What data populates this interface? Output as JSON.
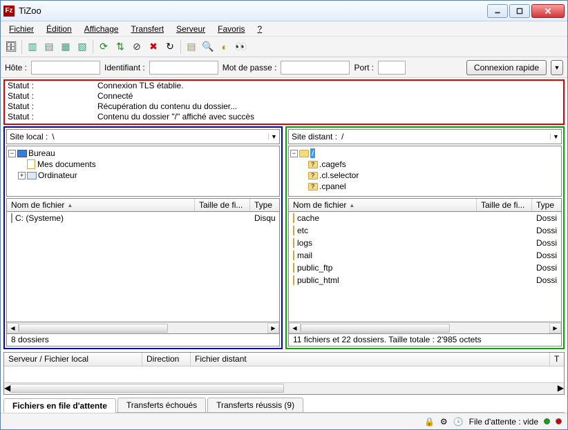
{
  "window": {
    "title": "TiZoo"
  },
  "menu": {
    "file": "Fichier",
    "edit": "Édition",
    "view": "Affichage",
    "transfer": "Transfert",
    "server": "Serveur",
    "bookmarks": "Favoris",
    "help": "?"
  },
  "quickconnect": {
    "host_label": "Hôte :",
    "user_label": "Identifiant :",
    "pass_label": "Mot de passe :",
    "port_label": "Port :",
    "button": "Connexion rapide"
  },
  "log": [
    {
      "label": "Statut :",
      "msg": "Connexion TLS établie."
    },
    {
      "label": "Statut :",
      "msg": "Connecté"
    },
    {
      "label": "Statut :",
      "msg": "Récupération du contenu du dossier..."
    },
    {
      "label": "Statut :",
      "msg": "Contenu du dossier \"/\" affiché avec succès"
    }
  ],
  "local": {
    "label": "Site local :",
    "path": "\\",
    "tree": {
      "root": "Bureau",
      "docs": "Mes documents",
      "computer": "Ordinateur"
    },
    "columns": {
      "name": "Nom de fichier",
      "size": "Taille de fi...",
      "type": "Type"
    },
    "rows": [
      {
        "name": "C: (Systeme)",
        "type": "Disqu"
      }
    ],
    "status": "8 dossiers"
  },
  "remote": {
    "label": "Site distant :",
    "path": "/",
    "tree": {
      "root": "/",
      "a": ".cagefs",
      "b": ".cl.selector",
      "c": ".cpanel"
    },
    "columns": {
      "name": "Nom de fichier",
      "size": "Taille de fi...",
      "type": "Type"
    },
    "rows": [
      {
        "name": "cache",
        "type": "Dossi"
      },
      {
        "name": "etc",
        "type": "Dossi"
      },
      {
        "name": "logs",
        "type": "Dossi"
      },
      {
        "name": "mail",
        "type": "Dossi"
      },
      {
        "name": "public_ftp",
        "type": "Dossi"
      },
      {
        "name": "public_html",
        "type": "Dossi"
      }
    ],
    "status": "11 fichiers et 22 dossiers. Taille totale : 2'985 octets"
  },
  "queue": {
    "columns": {
      "server": "Serveur / Fichier local",
      "direction": "Direction",
      "remote": "Fichier distant",
      "tail": "T"
    }
  },
  "tabs": {
    "queued": "Fichiers en file d'attente",
    "failed": "Transferts échoués",
    "success": "Transferts réussis (9)"
  },
  "statusbar": {
    "queue": "File d'attente : vide"
  }
}
